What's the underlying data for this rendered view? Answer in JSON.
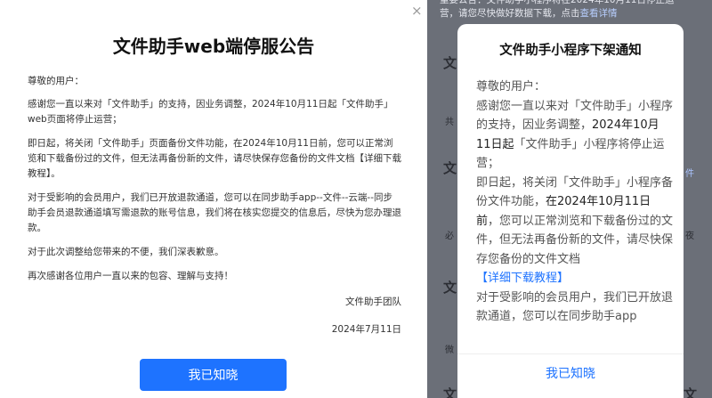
{
  "left_panel": {
    "close_icon": "×",
    "title": "文件助手web端停服公告",
    "greeting": "尊敬的用户：",
    "para1": "感谢您一直以来对「文件助手」的支持，因业务调整，2024年10月11日起「文件助手」web页面将停止运营；",
    "para2": "即日起，将关闭「文件助手」页面备份文件功能，在2024年10月11日前，您可以正常浏览和下载备份过的文件，但无法再备份新的文件，请尽快保存您备份的文件文档【详细下载教程】。",
    "para3": "对于受影响的会员用户，我们已开放退款通道，您可以在同步助手app--文件--云端--同步助手会员退款通道填写需退款的账号信息，我们将在核实您提交的信息后，尽快为您办理退款。",
    "para4": "对于此次调整给您带来的不便，我们深表歉意。",
    "para5": "再次感谢各位用户一直以来的包容、理解与支持！",
    "signature": "文件助手团队",
    "date": "2024年7月11日",
    "ack_button": "我已知晓"
  },
  "background": {
    "line1": "重要公告：文件助手小程序将在2024年10月11日停止运",
    "line2_pre": "营，请您尽快做好数据下载，点击",
    "line2_link": "查看详情",
    "side_chars": [
      "文",
      "文",
      "文",
      "文",
      "文"
    ],
    "right_labels": [
      "件",
      "夜"
    ],
    "left_labels": [
      "共",
      "必",
      "微"
    ]
  },
  "modal": {
    "title": "文件助手小程序下架通知",
    "greeting": "尊敬的用户：",
    "p1a": "感谢您一直以来对「文件助手」小程序的支持，因业务调整，",
    "p1b": "2024年10月11日起",
    "p1c": "「文件助手」小程序将停止运营；",
    "p2a": "即日起，将关闭「文件助手」小程序备份文件功能，",
    "p2b": "在2024年10月11日前",
    "p2c": "，您可以正常浏览和下载备份过的文件，但无法再备份新的文件，请尽快保存您备份的文件文档",
    "link": "【详细下载教程】",
    "p3": "对于受影响的会员用户，我们已开放退款通道，您可以在同步助手app",
    "ack_button": "我已知晓"
  },
  "colors": {
    "accent": "#1e73ff",
    "overlay": "#6b6f78"
  }
}
